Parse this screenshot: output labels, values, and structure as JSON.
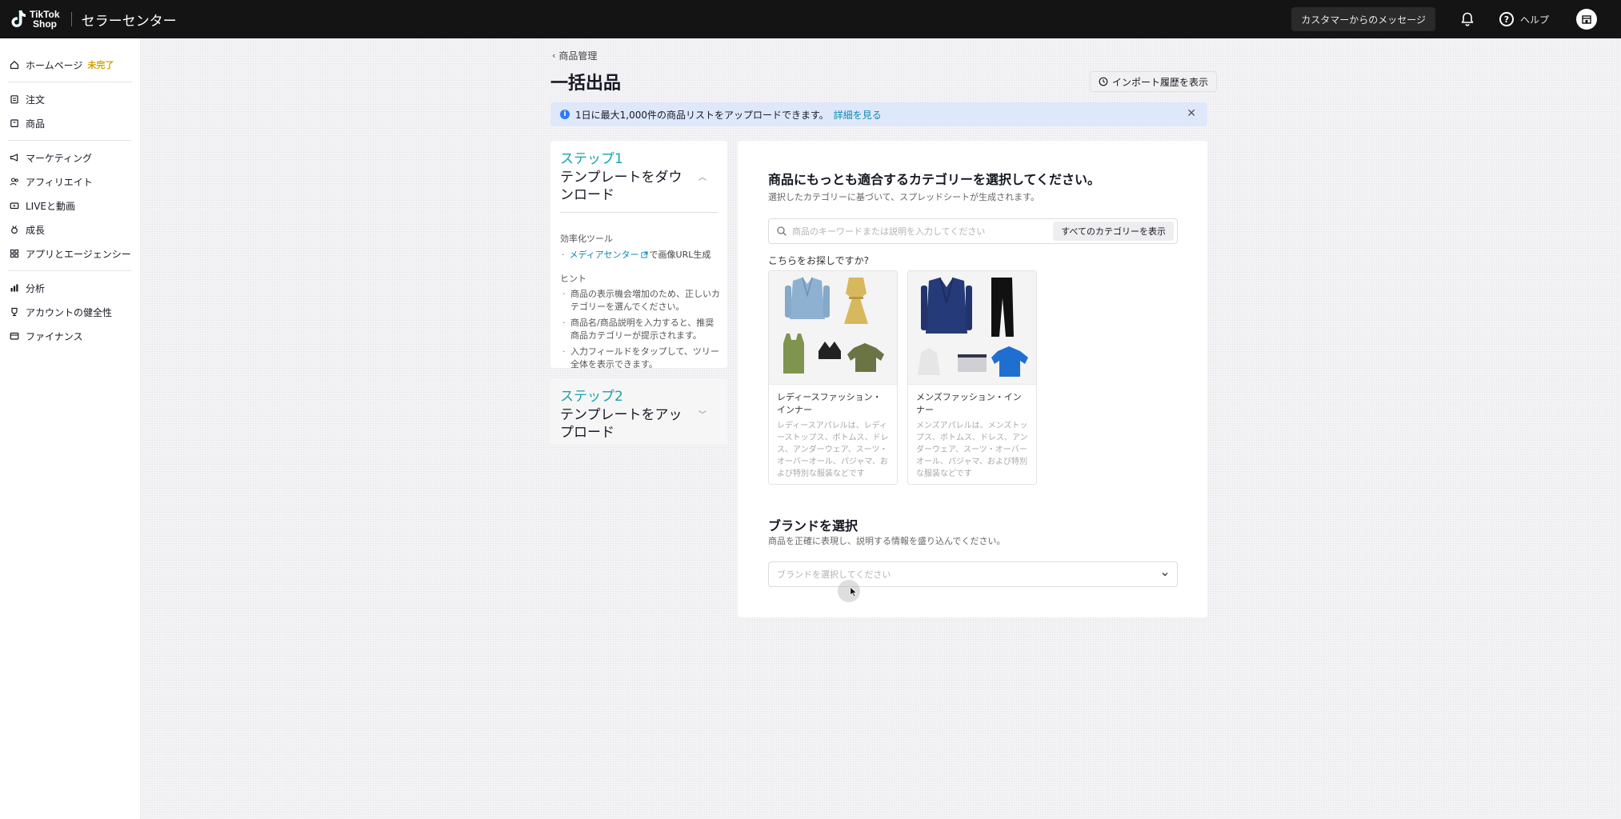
{
  "header": {
    "logo_line1": "TikTok",
    "logo_line2": "Shop",
    "title": "セラーセンター",
    "message_button": "カスタマーからのメッセージ",
    "help": "ヘルプ"
  },
  "sidebar": {
    "items": [
      {
        "label": "ホームページ",
        "icon": "home-icon",
        "badge": "未完了"
      },
      {
        "label": "注文",
        "icon": "clipboard-icon"
      },
      {
        "label": "商品",
        "icon": "box-icon"
      },
      {
        "label": "マーケティング",
        "icon": "megaphone-icon"
      },
      {
        "label": "アフィリエイト",
        "icon": "people-icon"
      },
      {
        "label": "LIVEと動画",
        "icon": "video-icon"
      },
      {
        "label": "成長",
        "icon": "medal-icon"
      },
      {
        "label": "アプリとエージェンシー",
        "icon": "apps-icon"
      },
      {
        "label": "分析",
        "icon": "chart-icon"
      },
      {
        "label": "アカウントの健全性",
        "icon": "trophy-icon"
      },
      {
        "label": "ファイナンス",
        "icon": "wallet-icon"
      }
    ]
  },
  "main": {
    "breadcrumb": "商品管理",
    "title": "一括出品",
    "import_history_button": "インポート履歴を表示",
    "banner": {
      "text": "1日に最大1,000件の商品リストをアップロードできます。",
      "link": "詳細を見る"
    },
    "step1": {
      "number": "ステップ1",
      "title": "テンプレートをダウンロード",
      "tools_label": "効率化ツール",
      "tool_link": "メディアセンター",
      "tool_suffix": "で画像URL生成",
      "hints_label": "ヒント",
      "hints": [
        "商品の表示機会増加のため、正しいカテゴリーを選んでください。",
        "商品名/商品説明を入力すると、推奨商品カテゴリーが提示されます。",
        "入力フィールドをタップして、ツリー全体を表示できます。"
      ]
    },
    "step2": {
      "number": "ステップ2",
      "title": "テンプレートをアップロード"
    },
    "category": {
      "title": "商品にもっとも適合するカテゴリーを選択してください。",
      "subtitle": "選択したカテゴリーに基づいて、スプレッドシートが生成されます。",
      "search_placeholder": "商品のキーワードまたは説明を入力してください",
      "all_categories_button": "すべてのカテゴリーを表示",
      "suggest_label": "こちらをお探しですか?",
      "cards": [
        {
          "name": "レディースファッション・インナー",
          "desc": "レディースアパレルは、レディーストップス、ボトムス、ドレス、アンダーウェア、スーツ・オーバーオール、パジャマ、および特別な服装などです"
        },
        {
          "name": "メンズファッション・インナー",
          "desc": "メンズアパレルは、メンズトップス、ボトムス、ドレス、アンダーウェア、スーツ・オーバーオール、パジャマ、および特別な服装などです"
        }
      ]
    },
    "brand": {
      "title": "ブランドを選択",
      "subtitle": "商品を正確に表現し、説明する情報を盛り込んでください。",
      "placeholder": "ブランドを選択してください"
    }
  },
  "colors": {
    "accent_teal": "#17a3a5",
    "link": "#0a8bb0",
    "badge": "#d6a100",
    "banner_bg": "#dfe8fa",
    "topbar": "#141414"
  }
}
